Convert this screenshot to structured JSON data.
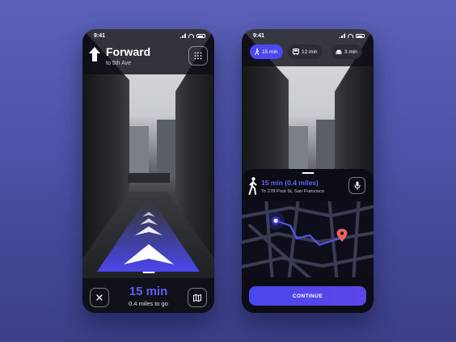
{
  "left_screen": {
    "status_time": "9:41",
    "direction": {
      "title": "Forward",
      "subtitle": "to 5th Ave"
    },
    "eta": {
      "time": "15 min",
      "distance": "0.4 miles to go"
    }
  },
  "right_screen": {
    "status_time": "9:41",
    "modes": [
      {
        "icon": "walk-icon",
        "label": "15 min",
        "selected": true
      },
      {
        "icon": "bus-icon",
        "label": "12 min",
        "selected": false
      },
      {
        "icon": "car-icon",
        "label": "3 min",
        "selected": false
      }
    ],
    "route": {
      "title": "15 min (0.4 miles)",
      "subtitle": "To 278 Post St, San Francisco"
    },
    "continue_label": "CONTINUE"
  },
  "colors": {
    "accent": "#4b48f0",
    "background": "#5a61b8",
    "pin": "#e8655a"
  }
}
